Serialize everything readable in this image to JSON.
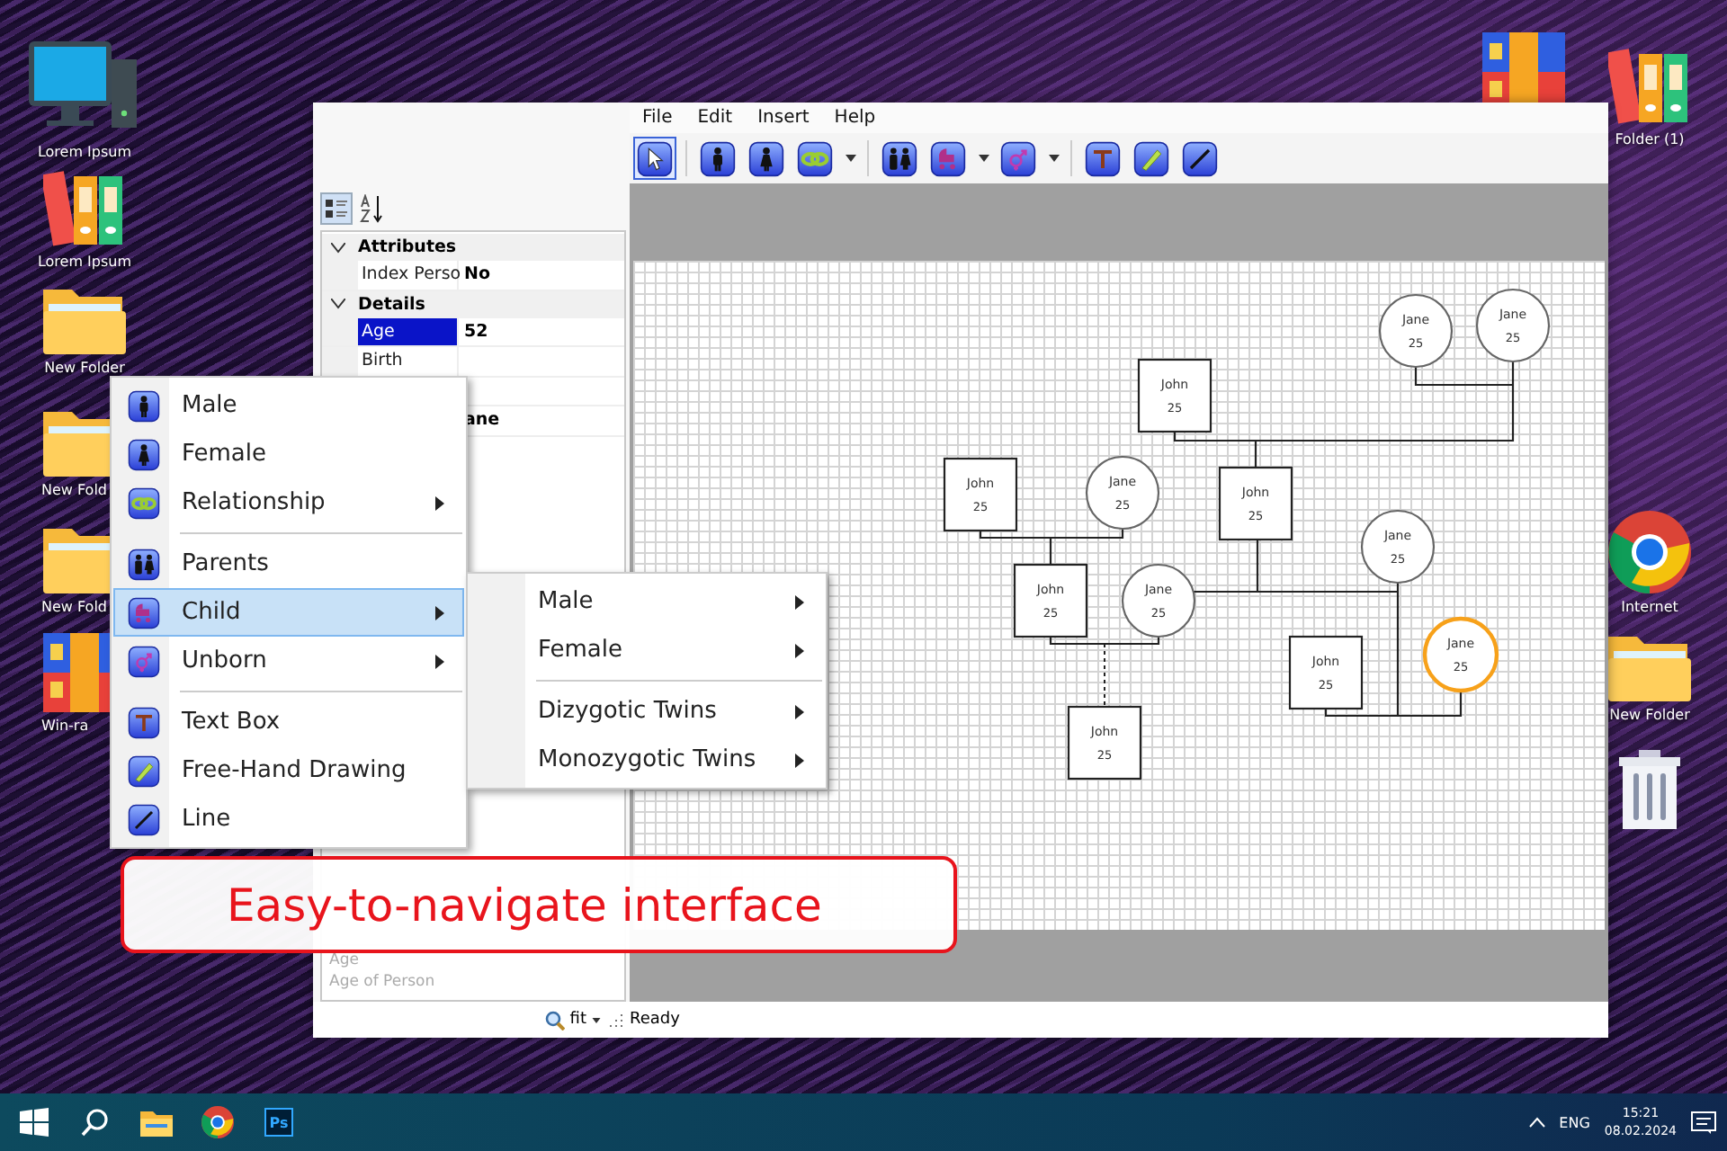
{
  "desktop_icons_left": [
    {
      "kind": "computer",
      "label": "Lorem Ipsum"
    },
    {
      "kind": "binders",
      "label": "Lorem Ipsum"
    },
    {
      "kind": "folder",
      "label": "New Folder"
    },
    {
      "kind": "folder",
      "label": "New Fold"
    },
    {
      "kind": "folder",
      "label": "New Fold"
    },
    {
      "kind": "winrar",
      "label": "Win-ra"
    }
  ],
  "desktop_icons_right": [
    {
      "kind": "winrar"
    },
    {
      "kind": "binders",
      "label": "Folder (1)"
    },
    {
      "kind": "chrome",
      "label": "Internet"
    },
    {
      "kind": "folder",
      "label": "New Folder"
    },
    {
      "kind": "trash"
    }
  ],
  "app": {
    "menu_bar": [
      "File",
      "Edit",
      "Insert",
      "Help"
    ],
    "toolbar": [
      {
        "kind": "pointer",
        "selected": true
      },
      {
        "kind": "male",
        "selected": false
      },
      {
        "kind": "female",
        "selected": false
      },
      {
        "kind": "relationship",
        "selected": false
      },
      {
        "kind": "parents",
        "selected": false
      },
      {
        "kind": "child",
        "selected": false
      },
      {
        "kind": "unborn",
        "selected": false
      },
      {
        "kind": "text",
        "selected": false
      },
      {
        "kind": "pencil",
        "selected": false
      },
      {
        "kind": "line",
        "selected": false
      }
    ],
    "properties": {
      "groups": [
        {
          "name": "Attributes",
          "expanded": true,
          "rows": [
            {
              "name": "Index Perso",
              "value": "No",
              "selected": false
            }
          ]
        },
        {
          "name": "Details",
          "expanded": true,
          "rows": [
            {
              "name": "Age",
              "value": "52",
              "selected": true
            },
            {
              "name": "Birth",
              "selected": false
            },
            {},
            {
              "value": "ane"
            }
          ]
        }
      ],
      "description": {
        "title": "Age",
        "text": "Age of Person"
      }
    },
    "genogram": {
      "nodes": [
        {
          "kind": "female",
          "name": "Jane",
          "age": "25",
          "selected": false
        },
        {
          "kind": "female",
          "name": "Jane",
          "age": "25",
          "selected": false
        },
        {
          "kind": "male",
          "name": "John",
          "age": "25",
          "selected": false
        },
        {
          "kind": "male",
          "name": "John",
          "age": "25",
          "selected": false
        },
        {
          "kind": "female",
          "name": "Jane",
          "age": "25",
          "selected": false
        },
        {
          "kind": "male",
          "name": "John",
          "age": "25",
          "selected": false
        },
        {
          "kind": "female",
          "name": "Jane",
          "age": "25",
          "selected": false
        },
        {
          "kind": "male",
          "name": "John",
          "age": "25",
          "selected": false
        },
        {
          "kind": "female",
          "name": "Jane",
          "age": "25",
          "selected": false
        },
        {
          "kind": "male",
          "name": "John",
          "age": "25",
          "selected": false
        },
        {
          "kind": "female",
          "name": "Jane",
          "age": "25",
          "selected": true
        },
        {
          "kind": "male",
          "name": "John",
          "age": "25",
          "selected": false
        }
      ]
    },
    "status_bar": {
      "zoom": "fit",
      "text": "Ready"
    }
  },
  "context_menu": {
    "items": [
      {
        "kind": "item",
        "label": "Male",
        "submenu": false,
        "selected": false
      },
      {
        "kind": "item",
        "label": "Female",
        "submenu": false,
        "selected": false
      },
      {
        "kind": "item",
        "label": "Relationship",
        "submenu": true,
        "selected": false
      },
      {
        "kind": "separator"
      },
      {
        "kind": "item",
        "label": "Parents",
        "submenu": false,
        "selected": false
      },
      {
        "kind": "item",
        "label": "Child",
        "submenu": true,
        "selected": true
      },
      {
        "kind": "item",
        "label": "Unborn",
        "submenu": true,
        "selected": false
      },
      {
        "kind": "separator"
      },
      {
        "kind": "item",
        "label": "Text Box",
        "submenu": false,
        "selected": false
      },
      {
        "kind": "item",
        "label": "Free-Hand Drawing",
        "submenu": false,
        "selected": false
      },
      {
        "kind": "item",
        "label": "Line",
        "submenu": false,
        "selected": false
      }
    ]
  },
  "submenu": {
    "items": [
      {
        "kind": "item",
        "label": "Male",
        "submenu": true,
        "selected": false
      },
      {
        "kind": "item",
        "label": "Female",
        "submenu": true,
        "selected": false
      },
      {
        "kind": "separator"
      },
      {
        "kind": "item",
        "label": "Dizygotic Twins",
        "submenu": true,
        "selected": false
      },
      {
        "kind": "item",
        "label": "Monozygotic Twins",
        "submenu": true,
        "selected": false
      }
    ]
  },
  "banner": {
    "text": "Easy-to-navigate interface"
  },
  "taskbar": {
    "apps": [
      {
        "kind": "start"
      },
      {
        "kind": "search"
      },
      {
        "kind": "explorer"
      },
      {
        "kind": "chrome"
      },
      {
        "kind": "photoshop",
        "label": "Ps"
      }
    ],
    "tray": {
      "language": "ENG",
      "time": "15:21",
      "date": "08.02.2024"
    }
  }
}
